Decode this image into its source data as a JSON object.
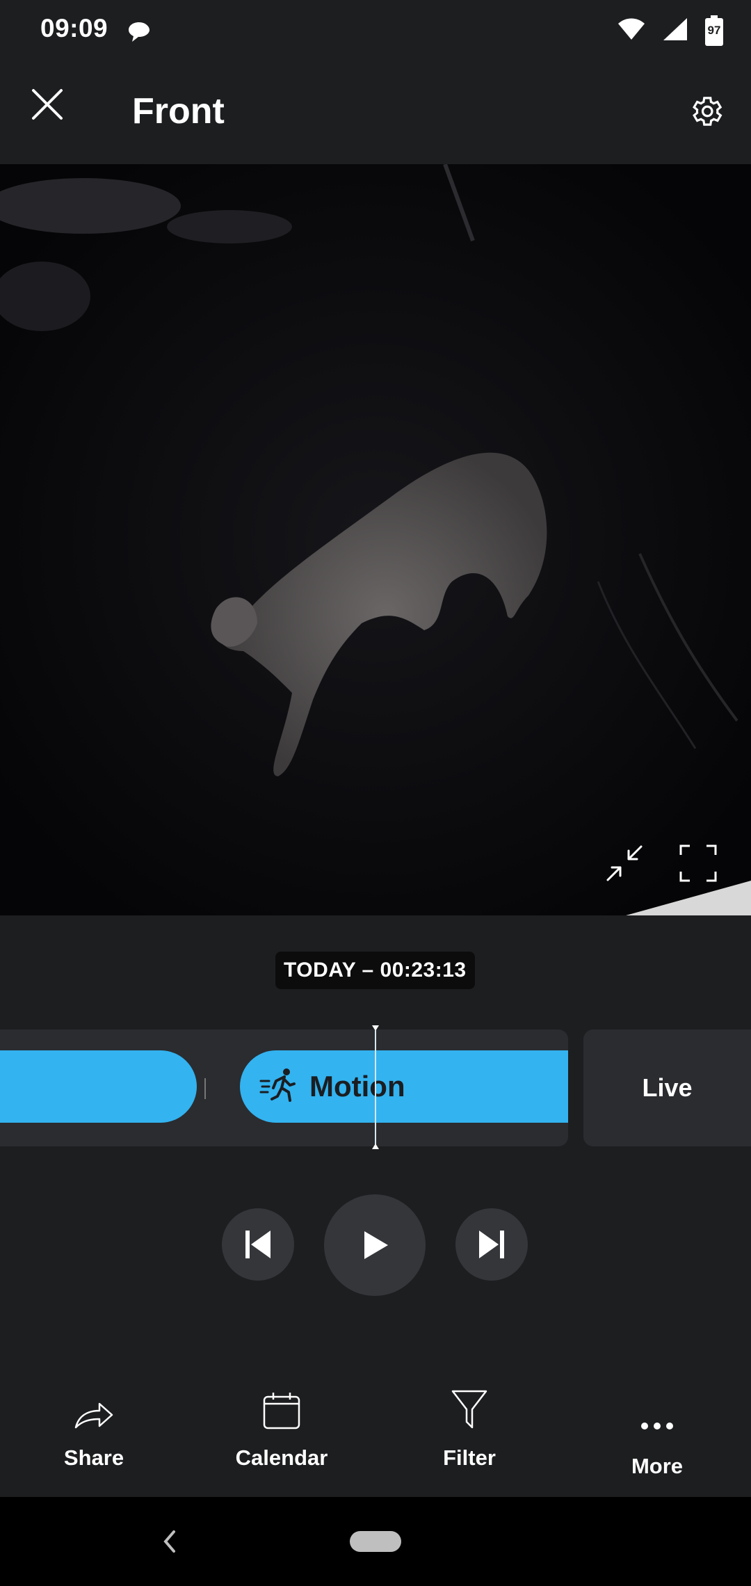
{
  "status_bar": {
    "time": "09:09",
    "battery": "97",
    "icons": [
      "chat-bubble-icon",
      "wifi-icon",
      "signal-icon",
      "battery-icon"
    ]
  },
  "header": {
    "title": "Front",
    "close_icon": "close-icon",
    "settings_icon": "gear-icon"
  },
  "video": {
    "tools": [
      "exit-fullscreen-icon",
      "fullscreen-icon"
    ]
  },
  "timeline": {
    "timestamp": "TODAY – 00:23:13",
    "event_label": "Motion",
    "event_icon": "running-person-icon",
    "live_label": "Live"
  },
  "playback": {
    "controls": [
      "skip-previous-icon",
      "play-icon",
      "skip-next-icon"
    ]
  },
  "bottom_nav": {
    "items": [
      {
        "label": "Share",
        "icon": "share-icon"
      },
      {
        "label": "Calendar",
        "icon": "calendar-icon"
      },
      {
        "label": "Filter",
        "icon": "filter-icon"
      },
      {
        "label": "More",
        "icon": "more-icon"
      }
    ]
  },
  "colors": {
    "accent": "#33b3f0",
    "background": "#1d1e20",
    "surface": "#2a2c30"
  }
}
